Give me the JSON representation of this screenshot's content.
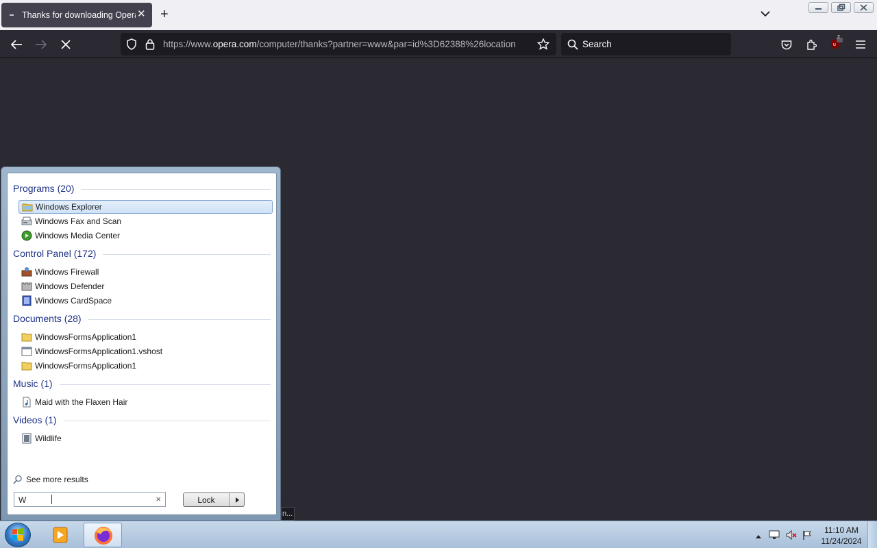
{
  "browser": {
    "tab": {
      "title": "Thanks for downloading Opera",
      "close": "✕"
    },
    "new_tab": "+",
    "url": {
      "prefix": "https://www.",
      "domain": "opera.com",
      "path": "/computer/thanks?partner=www&par=id%3D62388%26location"
    },
    "search_placeholder": "Search",
    "extensions_badge": "2"
  },
  "start_menu": {
    "groups": [
      {
        "heading": "Programs (20)",
        "items": [
          "Windows Explorer",
          "Windows Fax and Scan",
          "Windows Media Center"
        ]
      },
      {
        "heading": "Control Panel (172)",
        "items": [
          "Windows Firewall",
          "Windows Defender",
          "Windows CardSpace"
        ]
      },
      {
        "heading": "Documents (28)",
        "items": [
          "WindowsFormsApplication1",
          "WindowsFormsApplication1.vshost",
          "WindowsFormsApplication1"
        ]
      },
      {
        "heading": "Music (1)",
        "items": [
          "Maid with the Flaxen Hair"
        ]
      },
      {
        "heading": "Videos (1)",
        "items": [
          "Wildlife"
        ]
      }
    ],
    "see_more": "See more results",
    "search_value": "W",
    "clear": "×",
    "lock_label": "Lock"
  },
  "status_peek": "n...",
  "taskbar": {
    "time": "11:10 AM",
    "date": "11/24/2024"
  }
}
